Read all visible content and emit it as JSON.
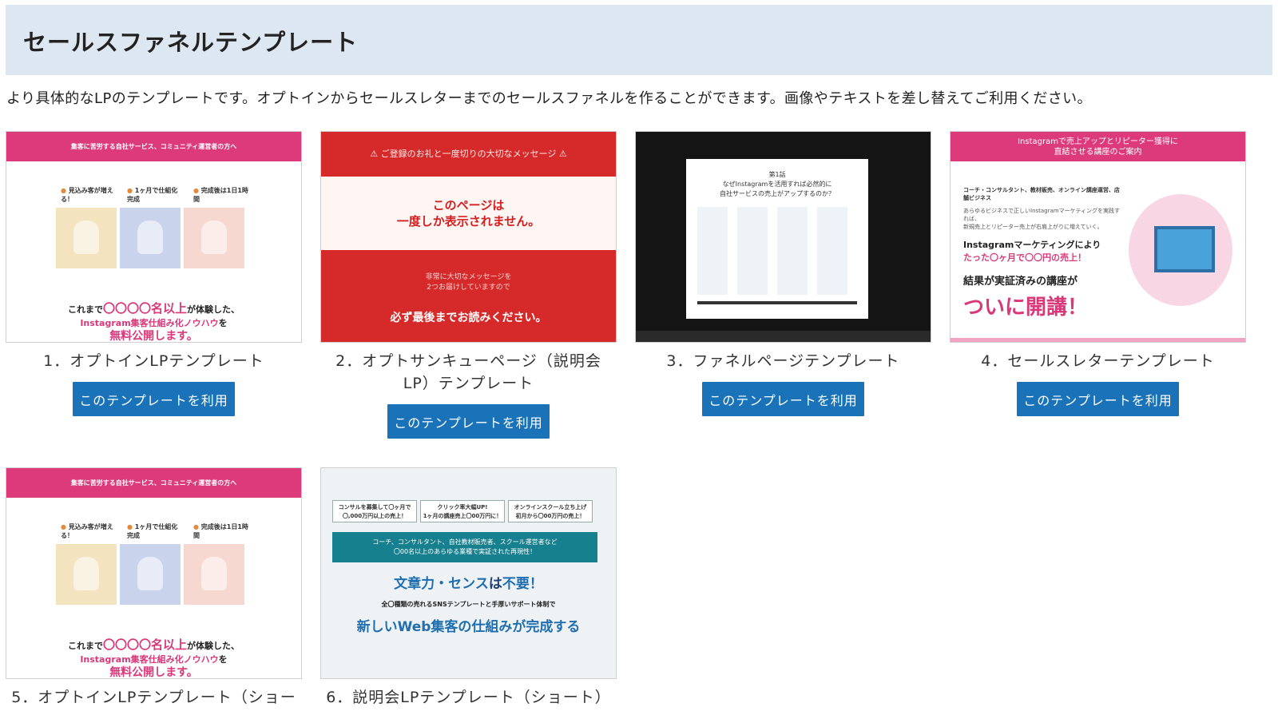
{
  "section": {
    "title": "セールスファネルテンプレート",
    "description": "より具体的なLPのテンプレートです。オプトインからセールスレターまでのセールスファネルを作ることができます。画像やテキストを差し替えてご利用ください。"
  },
  "button_label": "このテンプレートを利用",
  "cards": [
    {
      "caption": "1．オプトインLPテンプレート",
      "thumb": {
        "bar": "集客に苦労する自社サービス、コミュニティ運営者の方へ",
        "labels": [
          "見込み客が増える！",
          "1ヶ月で仕組化完成",
          "完成後は1日1時間"
        ],
        "line1_a": "これまで",
        "line1_b": "〇〇〇〇名以上",
        "line1_c": "が体験した、",
        "line2_a": "Instagram集客仕組み化ノウハウ",
        "line2_b": "を",
        "line3": "無料公開します。"
      }
    },
    {
      "caption": "2．オプトサンキューページ（説明会LP）テンプレート",
      "thumb": {
        "top": "⚠ ご登録のお礼と一度切りの大切なメッセージ ⚠",
        "mid1": "このページは",
        "mid2": "一度しか表示されません。",
        "sub1": "非常に大切なメッセージを",
        "sub2": "2つお届けしていますので",
        "bold": "必ず最後までお読みください。"
      }
    },
    {
      "caption": "3．ファネルページテンプレート",
      "thumb": {
        "chapter": "第1話",
        "line1": "なぜInstagramを活用すれば必然的に",
        "line2": "自社サービスの売上がアップするのか？"
      }
    },
    {
      "caption": "4．セールスレターテンプレート",
      "thumb": {
        "bar1": "Instagramで売上アップとリピーター獲得に",
        "bar2": "直結させる講座のご案内",
        "l1": "コーチ・コンサルタント、教材販売、オンライン講座運営、店舗ビジネス",
        "l2a": "あらゆるビジネスで正しいInstagramマーケティングを実践すれば、",
        "l2b": "新規売上とリピーター売上が右肩上がりに増えていく。",
        "l3a": "Instagramマーケティングにより",
        "l3b": "たった〇ヶ月で〇〇円の売上！",
        "l4": "結果が実証済みの講座が",
        "l5": "ついに開講！"
      }
    },
    {
      "caption": "5．オプトインLPテンプレート（ショー",
      "thumb": {
        "bar": "集客に苦労する自社サービス、コミュニティ運営者の方へ",
        "labels": [
          "見込み客が増える！",
          "1ヶ月で仕組化完成",
          "完成後は1日1時間"
        ],
        "line1_a": "これまで",
        "line1_b": "〇〇〇〇名以上",
        "line1_c": "が体験した、",
        "line2_a": "Instagram集客仕組み化ノウハウ",
        "line2_b": "を",
        "line3": "無料公開します。"
      }
    },
    {
      "caption": "6．説明会LPテンプレート（ショート）",
      "thumb": {
        "box1a": "コンサルを募集して〇ヶ月で",
        "box1b": "〇,000万円以上の売上！",
        "box2a": "クリック率大幅UP!",
        "box2b": "1ヶ月の講座売上〇00万円に！",
        "box3a": "オンラインスクール立ち上げ",
        "box3b": "初月から〇00万円の売上！",
        "teal1": "コーチ、コンサルタント、自社教材販売者、スクール運営者など",
        "teal2": "〇00名以上のあらゆる業種で実証された再現性！",
        "h1a": "文章力・センス",
        "h1b": "は",
        "h1c": "不要！",
        "sub": "全〇種類の売れるSNSテンプレートと手厚いサポート体制で",
        "h2": "新しいWeb集客の仕組みが完成する"
      }
    }
  ],
  "colors": {
    "header_bg": "#dde7f2",
    "button_bg": "#1a73b8",
    "pink": "#dd3a7c",
    "red": "#d62a2a",
    "teal": "#17808f"
  }
}
